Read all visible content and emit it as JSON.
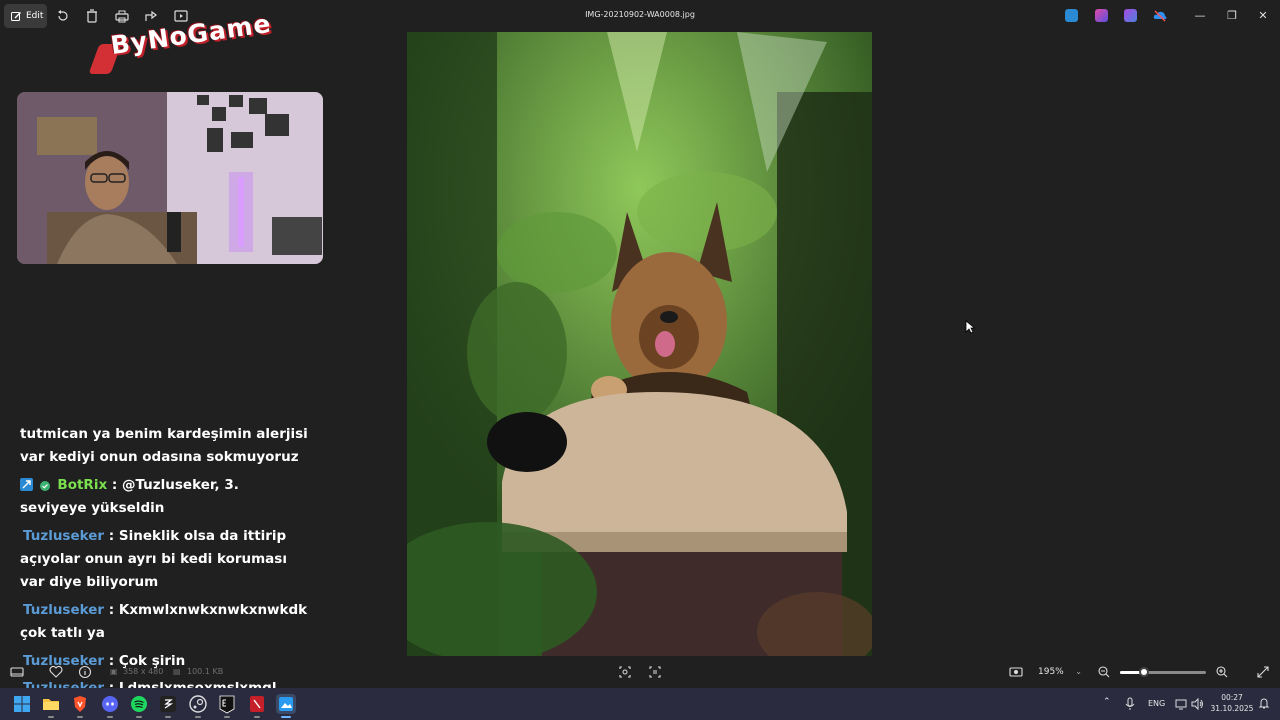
{
  "toolbar": {
    "edit_label": "Edit",
    "icons": [
      "edit-icon",
      "rotate-icon",
      "delete-icon",
      "print-icon",
      "share-icon",
      "slideshow-icon"
    ]
  },
  "window": {
    "title": "IMG-20210902-WA0008.jpg",
    "app_badges": [
      "clipchamp-icon",
      "copilot-icon",
      "designer-icon",
      "onedrive-icon"
    ],
    "controls": [
      "minimize-icon",
      "maximize-icon",
      "close-icon"
    ]
  },
  "overlay": {
    "logo_text": "ByNoGame",
    "chat": [
      {
        "user": "",
        "text": "tutmican ya benim kardeşimin alerjisi var kediyi onun odasına sokmuyoruz"
      },
      {
        "user": "BotRix",
        "text": ": @Tuzluseker, 3. seviyeye yükseldin",
        "bot": true
      },
      {
        "user": "Tuzluseker",
        "text": ": Sineklik olsa da ittirip açıyolar onun ayrı bi kedi koruması var diye biliyorum"
      },
      {
        "user": "Tuzluseker",
        "text": ": Kxmwlxnwkxnwkxnwkdk çok tatlı ya"
      },
      {
        "user": "Tuzluseker",
        "text": ": Çok şirin"
      },
      {
        "user": "Tuzluseker",
        "text": ": Ldmslxmsoxmslxmql"
      }
    ]
  },
  "bottombar": {
    "dimensions": "358 x 480",
    "filesize": "100.1 KB",
    "zoom": "195%",
    "zoom_level": 0.28
  },
  "taskbar": {
    "apps": [
      "windows-start-icon",
      "file-explorer-icon",
      "brave-browser-icon",
      "discord-icon",
      "spotify-icon",
      "obs-icon",
      "steam-icon",
      "epic-games-icon",
      "app-red-icon",
      "photos-icon"
    ],
    "lang": "ENG",
    "time": "00:27",
    "date": "31.10.2025"
  },
  "colors": {
    "accent": "#5b9bd5",
    "bot_name": "#7be04e",
    "background": "#202020",
    "taskbar": "#2b2b40"
  }
}
